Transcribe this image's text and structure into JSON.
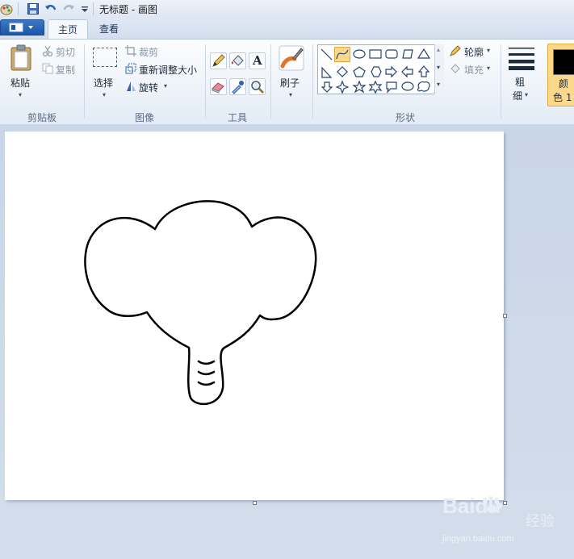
{
  "window": {
    "title": "无标题 - 画图"
  },
  "quick_access": [
    "paint-app-icon",
    "save-icon",
    "undo-icon",
    "redo-icon",
    "customize-dropdown-icon"
  ],
  "tabs": [
    {
      "label": "主页",
      "active": true
    },
    {
      "label": "查看",
      "active": false
    }
  ],
  "ribbon": {
    "clipboard": {
      "paste_label": "粘贴",
      "cut_label": "剪切",
      "copy_label": "复制",
      "group_label": "剪贴板"
    },
    "image": {
      "select_label": "选择",
      "crop_label": "裁剪",
      "resize_label": "重新调整大小",
      "rotate_label": "旋转",
      "group_label": "图像"
    },
    "tools": {
      "items": [
        "pencil-icon",
        "fill-icon",
        "text-icon",
        "eraser-icon",
        "color-picker-icon",
        "magnifier-icon"
      ],
      "text_glyph": "A",
      "group_label": "工具"
    },
    "brushes": {
      "label": "刷子"
    },
    "shapes": {
      "group_label": "形状",
      "selected": "curve",
      "outline_label": "轮廓",
      "fill_label": "填充"
    },
    "size": {
      "label_line1": "粗",
      "label_line2": "细"
    },
    "colors": {
      "label_line1": "颜",
      "label_line2": "色 1",
      "color1": "#000000"
    }
  },
  "accent": {
    "selection_bg": "#fbd88a",
    "file_button": "#1c56a8"
  },
  "watermark": {
    "brand": "Baidu",
    "cn": "经验",
    "url": "jingyan.baidu.com"
  }
}
